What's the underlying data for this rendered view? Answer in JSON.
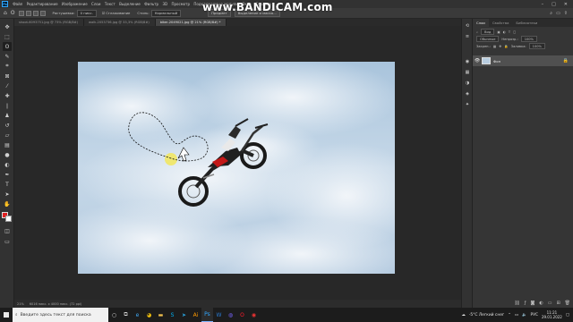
{
  "watermark": "www.BANDICAM.com",
  "menu": {
    "logo": "Ps",
    "items": [
      "Файл",
      "Редактирование",
      "Изображение",
      "Слои",
      "Текст",
      "Выделение",
      "Фильтр",
      "3D",
      "Просмотр",
      "Подключаемые модули",
      "Окно",
      "Справка"
    ],
    "window_controls": [
      "–",
      "□",
      "✕"
    ]
  },
  "options": {
    "feather_label": "Растушевка:",
    "feather_value": "0 пикс.",
    "smoothing_label": "Сглаживание",
    "style_label": "Стиль:",
    "style_value": "Нормальный",
    "select_subject": "Предмет",
    "select_mask": "Выделение и маска..."
  },
  "tabs": [
    "shoot-6093751.jpg @ 73% (RGB/8#)",
    "walk-2053736.jpg @ 33,3% (RGB/8#)",
    "biker-2049021.jpg @ 21% (RGB/8#) *"
  ],
  "status": {
    "zoom": "21%",
    "doc": "6016 пикс. x 4000 пикс. (72 ppi)"
  },
  "panels": {
    "tabs": [
      "Слои",
      "Свойства",
      "Библиотеки"
    ],
    "kind": "Вид",
    "mode": "Обычные",
    "opacity_label": "Непрозр.:",
    "opacity_value": "100%",
    "lock_label": "Закреп.:",
    "fill_label": "Заливка:",
    "fill_value": "100%",
    "layer_name": "Фон"
  },
  "taskbar": {
    "search_placeholder": "Введите здесь текст для поиска",
    "weather": "-5°C  Легкий снег",
    "lang": "РУС",
    "time": "11:21",
    "date": "29.01.2022"
  },
  "colors": {
    "foreground": "#e02020",
    "background": "#ffffff",
    "accent": "#31a8ff"
  }
}
